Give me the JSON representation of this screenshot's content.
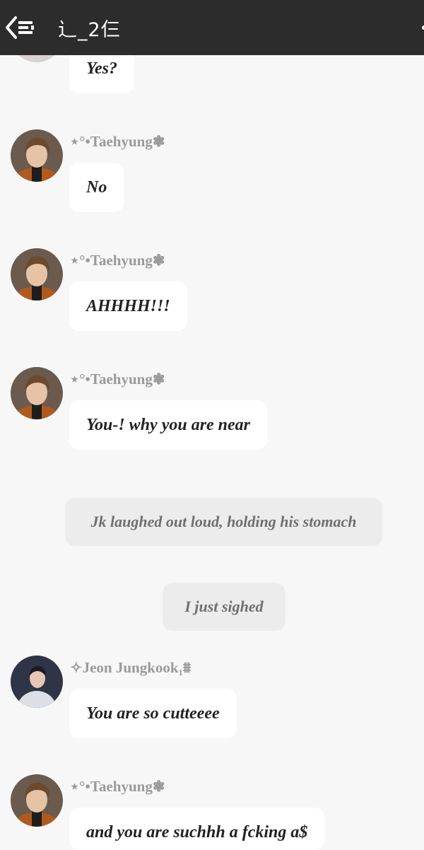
{
  "header": {
    "title": "辶_2仨",
    "back_icon": "back-list-icon",
    "background": "#2c2c2c"
  },
  "users": {
    "taehyung": "⋆°•Taehyung❃",
    "jungkook": "✧Jeon Jungkook₁⩩"
  },
  "messages": [
    {
      "sender": "Jeon Jungkook",
      "text": "Yes?"
    },
    {
      "sender": "⋆°•Taehyung❃",
      "text": "No"
    },
    {
      "sender": "⋆°•Taehyung❃",
      "text": "AHHHH!!!"
    },
    {
      "sender": "⋆°•Taehyung❃",
      "text": "You-! why you are near"
    },
    {
      "narration": "Jk laughed out loud, holding his stomach"
    },
    {
      "narration": "I just sighed"
    },
    {
      "sender": "✧Jeon Jungkook₁⩩",
      "text": "You are so cutteeee"
    },
    {
      "sender": "⋆°•Taehyung❃",
      "text": "and you are suchhh a fcking a$"
    }
  ],
  "colors": {
    "page_bg": "#f7f7f7",
    "bubble_bg": "#ffffff",
    "narration_bg": "#ececec",
    "name_color": "#9a9a9a"
  }
}
